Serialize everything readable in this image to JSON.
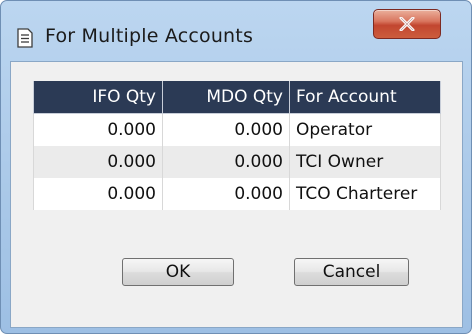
{
  "window": {
    "title": "For Multiple Accounts",
    "icon": "document-list-icon",
    "close_icon": "close-icon"
  },
  "table": {
    "columns": [
      "IFO Qty",
      "MDO Qty",
      "For Account"
    ],
    "rows": [
      {
        "ifo": "0.000",
        "mdo": "0.000",
        "account": "Operator"
      },
      {
        "ifo": "0.000",
        "mdo": "0.000",
        "account": "TCI Owner"
      },
      {
        "ifo": "0.000",
        "mdo": "0.000",
        "account": "TCO Charterer"
      }
    ]
  },
  "buttons": {
    "ok": "OK",
    "cancel": "Cancel"
  },
  "colors": {
    "header_bg": "#2b3a55",
    "frame": "#a9c8e8",
    "close_button": "#c24630"
  }
}
